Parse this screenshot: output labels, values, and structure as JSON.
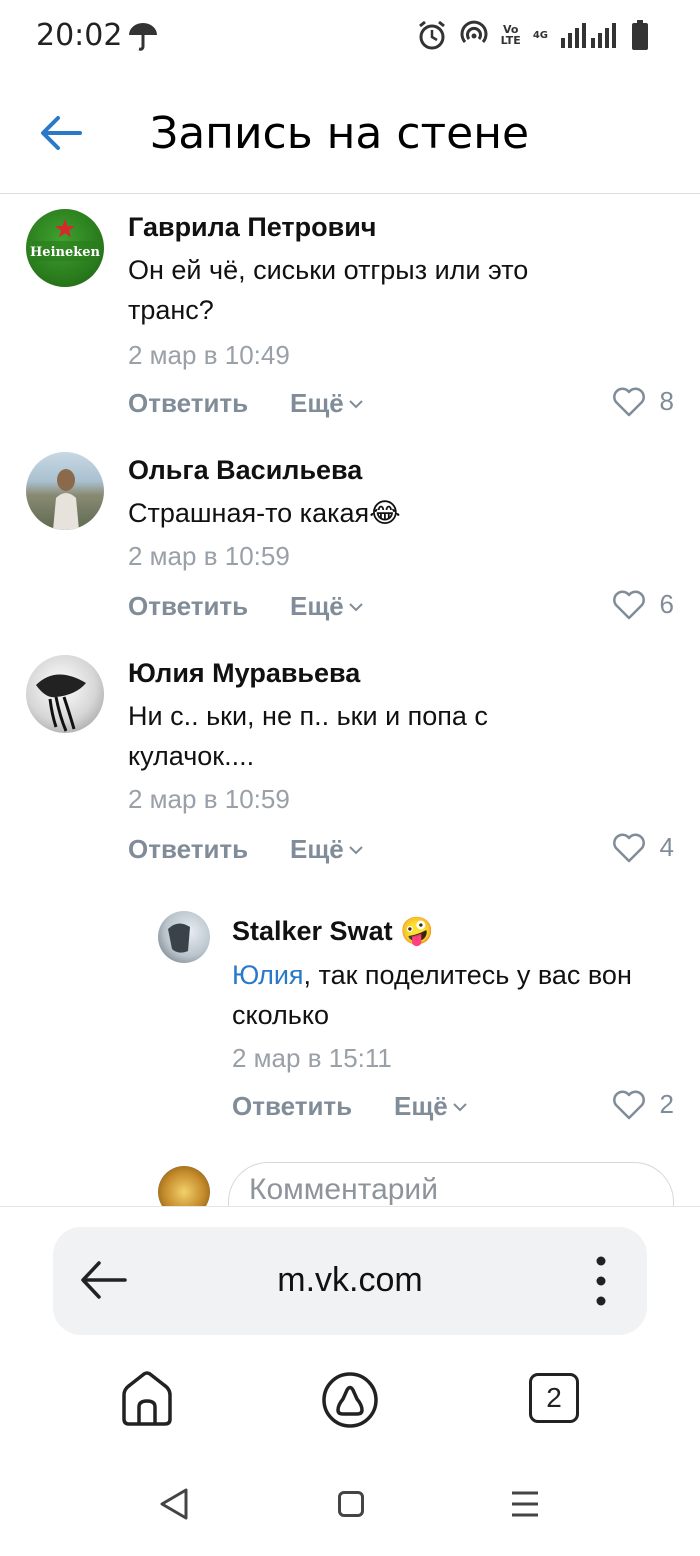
{
  "status_bar": {
    "time": "20:02",
    "network_label_top": "Vo",
    "network_label_bottom": "LTE",
    "network_gen": "4G",
    "icons": [
      "umbrella-icon",
      "alarm-icon",
      "hotspot-icon",
      "signal-icon",
      "battery-icon"
    ]
  },
  "header": {
    "title": "Запись на стене",
    "back_icon": "arrow-left-icon",
    "accent_color": "#2a78c8"
  },
  "comments": [
    {
      "author": "Гаврила Петрович",
      "text": "Он ей чё, сиськи отгрыз или это транс?",
      "date": "2 мар в 10:49",
      "reply_label": "Ответить",
      "more_label": "Ещё",
      "likes": "8",
      "avatar_text": "Heineken"
    },
    {
      "author": "Ольга Васильева",
      "text": "Страшная-то какая😂",
      "date": "2 мар в 10:59",
      "reply_label": "Ответить",
      "more_label": "Ещё",
      "likes": "6"
    },
    {
      "author": "Юлия Муравьева",
      "text": "Ни с.. ьки, не п.. ьки и попа с кулачок....",
      "date": "2 мар в 10:59",
      "reply_label": "Ответить",
      "more_label": "Ещё",
      "likes": "4"
    }
  ],
  "reply": {
    "author": "Stalker Swat",
    "author_emoji": "🤪",
    "mention": "Юлия",
    "text": ", так поделитесь у вас вон сколько",
    "date": "2 мар в 15:11",
    "reply_label": "Ответить",
    "more_label": "Ещё",
    "likes": "2"
  },
  "comment_input": {
    "placeholder": "Комментарий"
  },
  "browser": {
    "url": "m.vk.com",
    "tab_count": "2"
  }
}
